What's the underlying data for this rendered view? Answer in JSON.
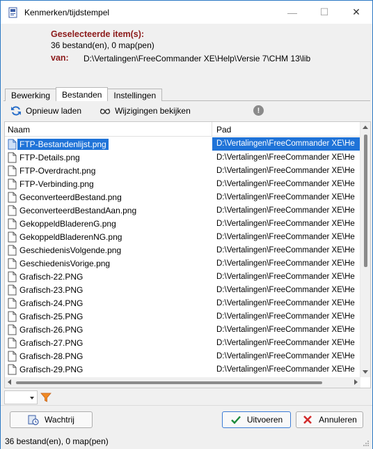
{
  "window": {
    "title": "Kenmerken/tijdstempel"
  },
  "header": {
    "selected_label": "Geselecteerde item(s):",
    "selected_count": "36 bestand(en), 0 map(pen)",
    "from_label": "van:",
    "from_path": "D:\\Vertalingen\\FreeCommander XE\\Help\\Versie 7\\CHM 13\\lib"
  },
  "tabs": [
    {
      "label": "Bewerking",
      "active": false
    },
    {
      "label": "Bestanden",
      "active": true
    },
    {
      "label": "Instellingen",
      "active": false
    }
  ],
  "toolbar": {
    "reload_label": "Opnieuw laden",
    "view_changes_label": "Wijzigingen bekijken"
  },
  "list": {
    "columns": [
      "Naam",
      "Pad"
    ],
    "rows": [
      {
        "name": "FTP-Bestandenlijst.png",
        "path": "D:\\Vertalingen\\FreeCommander XE\\He",
        "selected": true
      },
      {
        "name": "FTP-Details.png",
        "path": "D:\\Vertalingen\\FreeCommander XE\\He"
      },
      {
        "name": "FTP-Overdracht.png",
        "path": "D:\\Vertalingen\\FreeCommander XE\\He"
      },
      {
        "name": "FTP-Verbinding.png",
        "path": "D:\\Vertalingen\\FreeCommander XE\\He"
      },
      {
        "name": "GeconverteerdBestand.png",
        "path": "D:\\Vertalingen\\FreeCommander XE\\He"
      },
      {
        "name": "GeconverteerdBestandAan.png",
        "path": "D:\\Vertalingen\\FreeCommander XE\\He"
      },
      {
        "name": "GekoppeldBladerenG.png",
        "path": "D:\\Vertalingen\\FreeCommander XE\\He"
      },
      {
        "name": "GekoppeldBladerenNG.png",
        "path": "D:\\Vertalingen\\FreeCommander XE\\He"
      },
      {
        "name": "GeschiedenisVolgende.png",
        "path": "D:\\Vertalingen\\FreeCommander XE\\He"
      },
      {
        "name": "GeschiedenisVorige.png",
        "path": "D:\\Vertalingen\\FreeCommander XE\\He"
      },
      {
        "name": "Grafisch-22.PNG",
        "path": "D:\\Vertalingen\\FreeCommander XE\\He"
      },
      {
        "name": "Grafisch-23.PNG",
        "path": "D:\\Vertalingen\\FreeCommander XE\\He"
      },
      {
        "name": "Grafisch-24.PNG",
        "path": "D:\\Vertalingen\\FreeCommander XE\\He"
      },
      {
        "name": "Grafisch-25.PNG",
        "path": "D:\\Vertalingen\\FreeCommander XE\\He"
      },
      {
        "name": "Grafisch-26.PNG",
        "path": "D:\\Vertalingen\\FreeCommander XE\\He"
      },
      {
        "name": "Grafisch-27.PNG",
        "path": "D:\\Vertalingen\\FreeCommander XE\\He"
      },
      {
        "name": "Grafisch-28.PNG",
        "path": "D:\\Vertalingen\\FreeCommander XE\\He"
      },
      {
        "name": "Grafisch-29.PNG",
        "path": "D:\\Vertalingen\\FreeCommander XE\\He"
      }
    ]
  },
  "buttons": {
    "queue_label": "Wachtrij",
    "run_label": "Uitvoeren",
    "cancel_label": "Annuleren"
  },
  "status": {
    "text": "36 bestand(en), 0 map(pen)"
  },
  "colors": {
    "accent": "#1f73d8",
    "header_label": "#8b1a1a",
    "run_check": "#1a8a3a",
    "cancel_x": "#d22a2a"
  }
}
